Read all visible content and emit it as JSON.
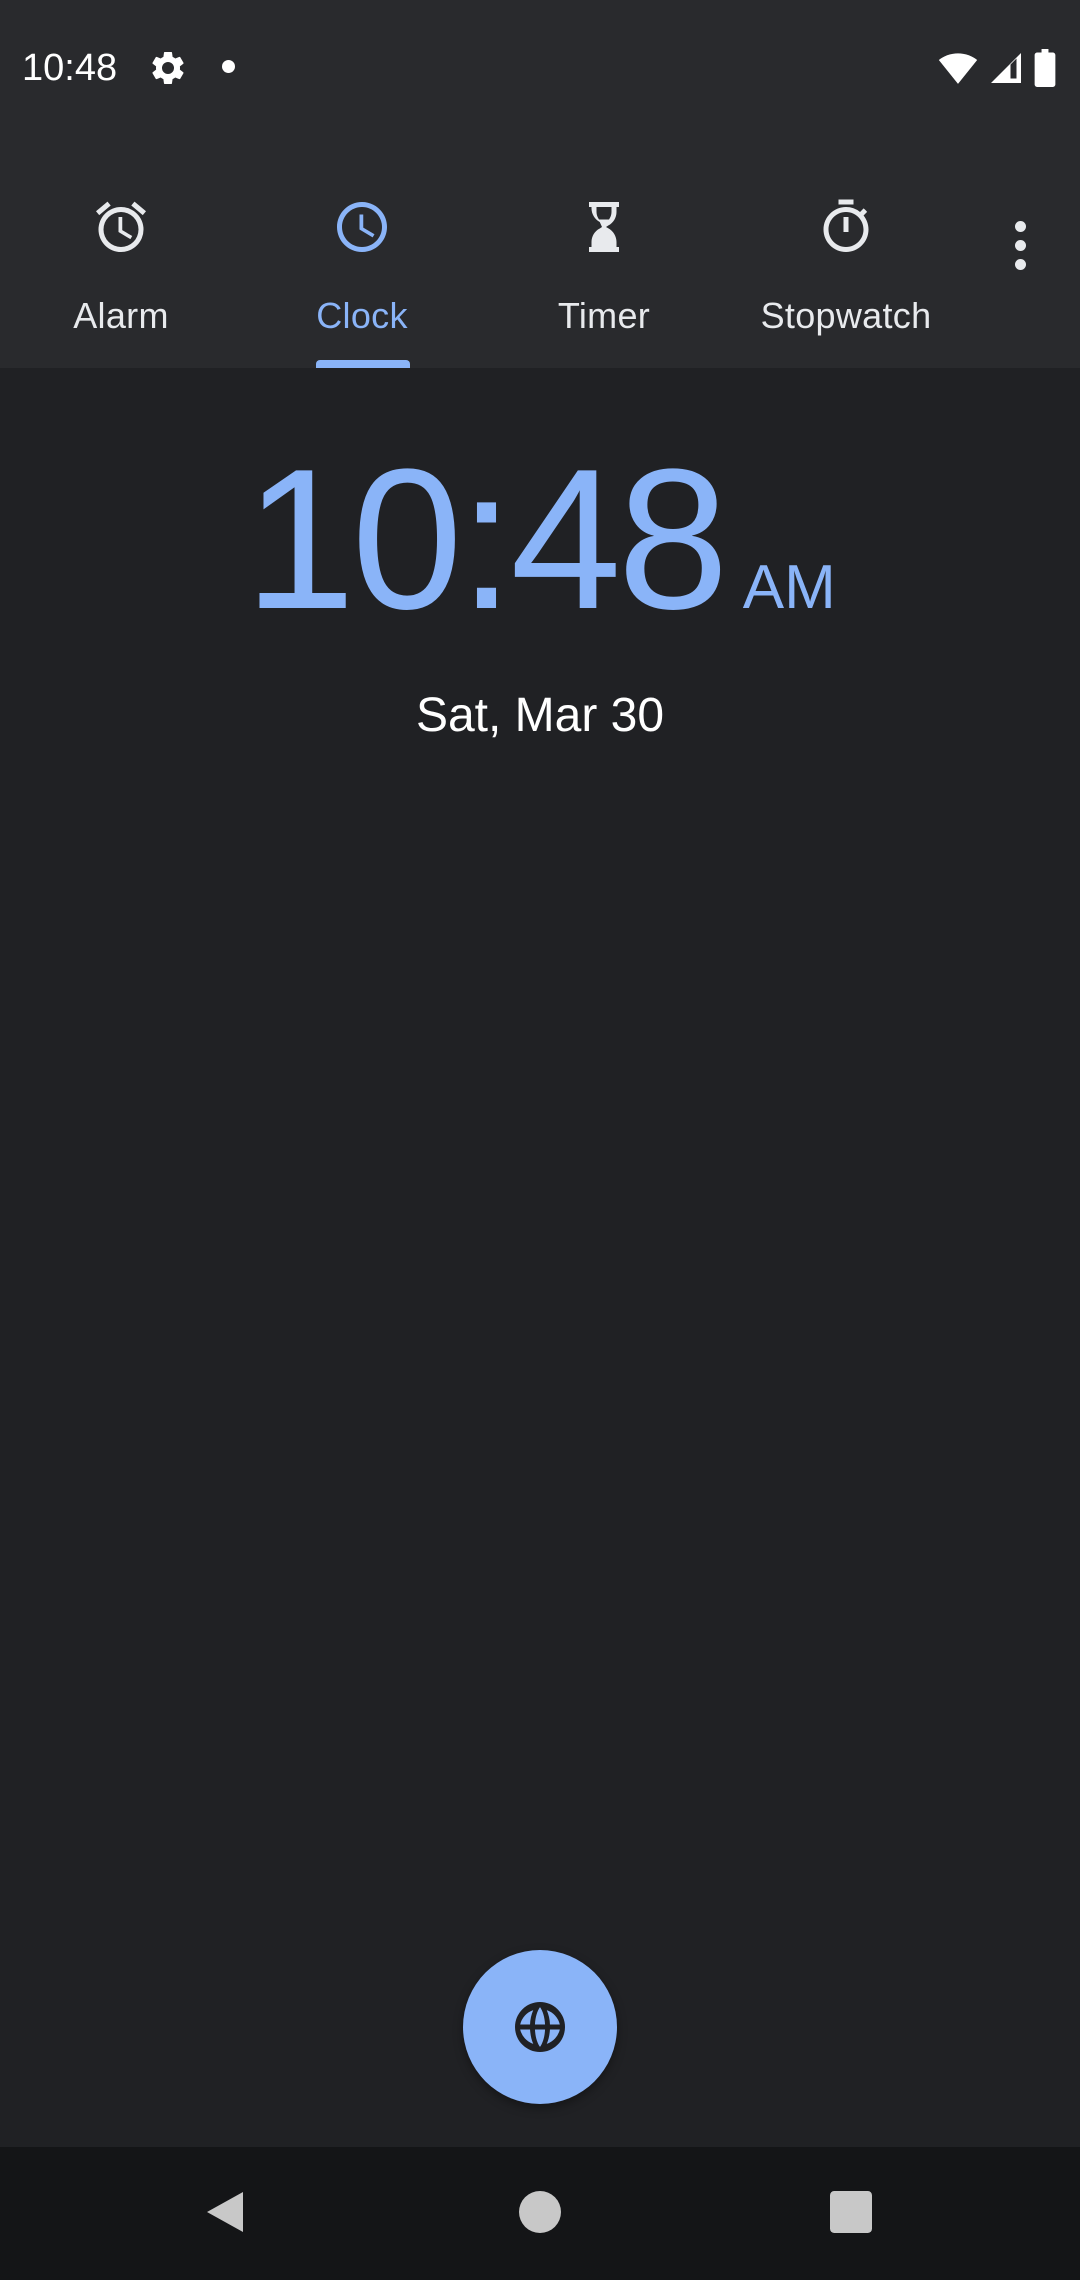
{
  "status_bar": {
    "time": "10:48",
    "icons": [
      "settings-gear-icon",
      "notification-dot-icon",
      "wifi-icon",
      "cellular-signal-icon",
      "battery-icon"
    ]
  },
  "tabs": [
    {
      "label": "Alarm",
      "icon": "alarm-clock-icon",
      "active": false
    },
    {
      "label": "Clock",
      "icon": "clock-icon",
      "active": true
    },
    {
      "label": "Timer",
      "icon": "hourglass-icon",
      "active": false
    },
    {
      "label": "Stopwatch",
      "icon": "stopwatch-icon",
      "active": false
    }
  ],
  "menu": {
    "icon": "more-vert-icon"
  },
  "clock": {
    "time": "10:48",
    "ampm": "AM",
    "date": "Sat, Mar 30"
  },
  "fab": {
    "icon": "globe-icon"
  },
  "nav": {
    "icons": [
      "back-icon",
      "home-icon",
      "recents-icon"
    ]
  },
  "colors": {
    "accent": "#8ab4f8",
    "background": "#202124",
    "tab_bar": "#292a2d",
    "nav_bar": "#141517",
    "text": "#e8eaed"
  }
}
